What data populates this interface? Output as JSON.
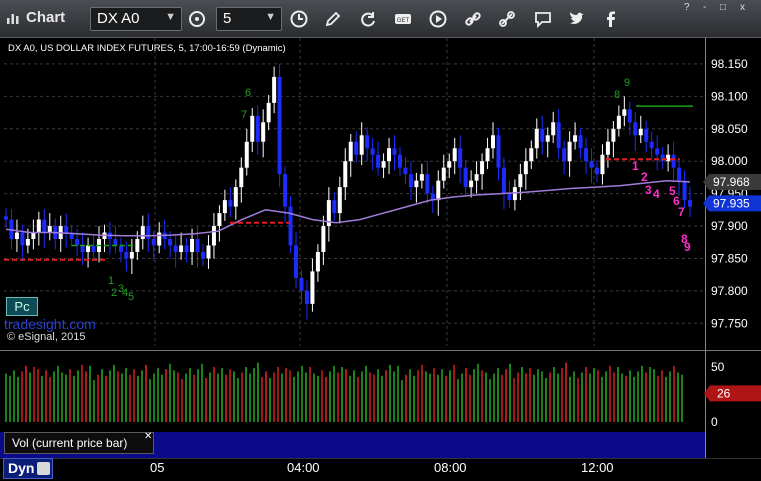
{
  "toolbar": {
    "app_title": "Chart",
    "symbol": "DX A0",
    "interval": "5",
    "buttons": [
      "interval-clock-icon",
      "draw-pencil-icon",
      "refresh-icon",
      "get-icon",
      "play-icon",
      "link-icon",
      "chat-icon",
      "twitter-icon",
      "facebook-icon"
    ],
    "window_controls": [
      "?",
      "-",
      "□",
      "x"
    ]
  },
  "chart": {
    "title": "DX A0, US DOLLAR INDEX FUTURES, 5, 17:00-16:59 (Dynamic)",
    "pc_badge": "Pc",
    "brand": "tradesight.com",
    "copyright": "© eSignal, 2015",
    "colors": {
      "up": "#ffffff",
      "down": "#1c2cff",
      "ma": "#a07cd8",
      "pivot_red": "#e02020",
      "pivot_green": "#1aa01a",
      "td_count": "#ff2ecb",
      "setup_green": "#21a021",
      "grid": "#3a3a3a"
    }
  },
  "chart_data": {
    "type": "candlestick",
    "title": "DX A0, US DOLLAR INDEX FUTURES, 5, 17:00-16:59 (Dynamic)",
    "y_ticks": [
      98.15,
      98.1,
      98.05,
      98.0,
      97.95,
      97.9,
      97.85,
      97.8,
      97.75
    ],
    "ylim": [
      97.715,
      98.19
    ],
    "x_labels": [
      "05",
      "04:00",
      "08:00",
      "12:00"
    ],
    "price_labels": [
      {
        "value": "97.968",
        "price": 97.968,
        "style": "grey"
      },
      {
        "value": "97.935",
        "price": 97.935,
        "style": "blue"
      }
    ],
    "closes": [
      97.91,
      97.88,
      97.89,
      97.87,
      97.88,
      97.89,
      97.91,
      97.89,
      97.9,
      97.88,
      97.9,
      97.89,
      97.88,
      97.87,
      97.86,
      97.87,
      97.86,
      97.88,
      97.89,
      97.88,
      97.87,
      97.86,
      97.85,
      97.86,
      97.88,
      97.9,
      97.88,
      97.87,
      97.89,
      97.88,
      97.87,
      97.86,
      97.87,
      97.86,
      97.88,
      97.86,
      97.85,
      97.87,
      97.9,
      97.92,
      97.94,
      97.93,
      97.96,
      97.99,
      98.03,
      98.07,
      98.03,
      98.06,
      98.09,
      98.13,
      97.98,
      97.93,
      97.87,
      97.82,
      97.8,
      97.78,
      97.83,
      97.86,
      97.9,
      97.94,
      97.92,
      97.96,
      98.0,
      98.03,
      98.01,
      98.04,
      98.02,
      98.01,
      97.99,
      98.0,
      98.02,
      98.01,
      97.99,
      97.98,
      97.96,
      97.97,
      97.98,
      97.95,
      97.94,
      97.97,
      97.99,
      98.0,
      98.02,
      97.99,
      97.96,
      97.97,
      97.98,
      98.0,
      98.02,
      98.04,
      97.99,
      97.95,
      97.94,
      97.96,
      97.98,
      98.0,
      98.02,
      98.05,
      98.03,
      98.04,
      98.06,
      98.02,
      98.0,
      98.03,
      98.04,
      98.02,
      98.0,
      97.99,
      97.98,
      98.01,
      98.03,
      98.05,
      98.07,
      98.08,
      98.06,
      98.04,
      98.05,
      98.03,
      98.02,
      98.01,
      98.0,
      98.01,
      97.99,
      97.97,
      97.94,
      97.93
    ],
    "series": [
      {
        "name": "moving-average",
        "values": [
          97.895,
          97.89,
          97.89,
          97.888,
          97.886,
          97.885,
          97.885,
          97.886,
          97.888,
          97.892,
          97.91,
          97.925,
          97.92,
          97.91,
          97.905,
          97.91,
          97.92,
          97.93,
          97.94,
          97.945,
          97.948,
          97.95,
          97.952,
          97.955,
          97.958,
          97.96,
          97.962,
          97.966,
          97.97,
          97.968
        ]
      }
    ],
    "volume": {
      "ticks": [
        50,
        25,
        0
      ],
      "current": "26",
      "label": "Vol (current price bar)"
    },
    "td_counts": [
      "1",
      "2",
      "3",
      "4",
      "5",
      "6",
      "7",
      "8",
      "9"
    ],
    "setup_counts_green": [
      "1",
      "2",
      "3",
      "4",
      "5",
      "6",
      "7",
      "8",
      "9"
    ]
  },
  "footer": {
    "dyn_label": "Dyn"
  }
}
